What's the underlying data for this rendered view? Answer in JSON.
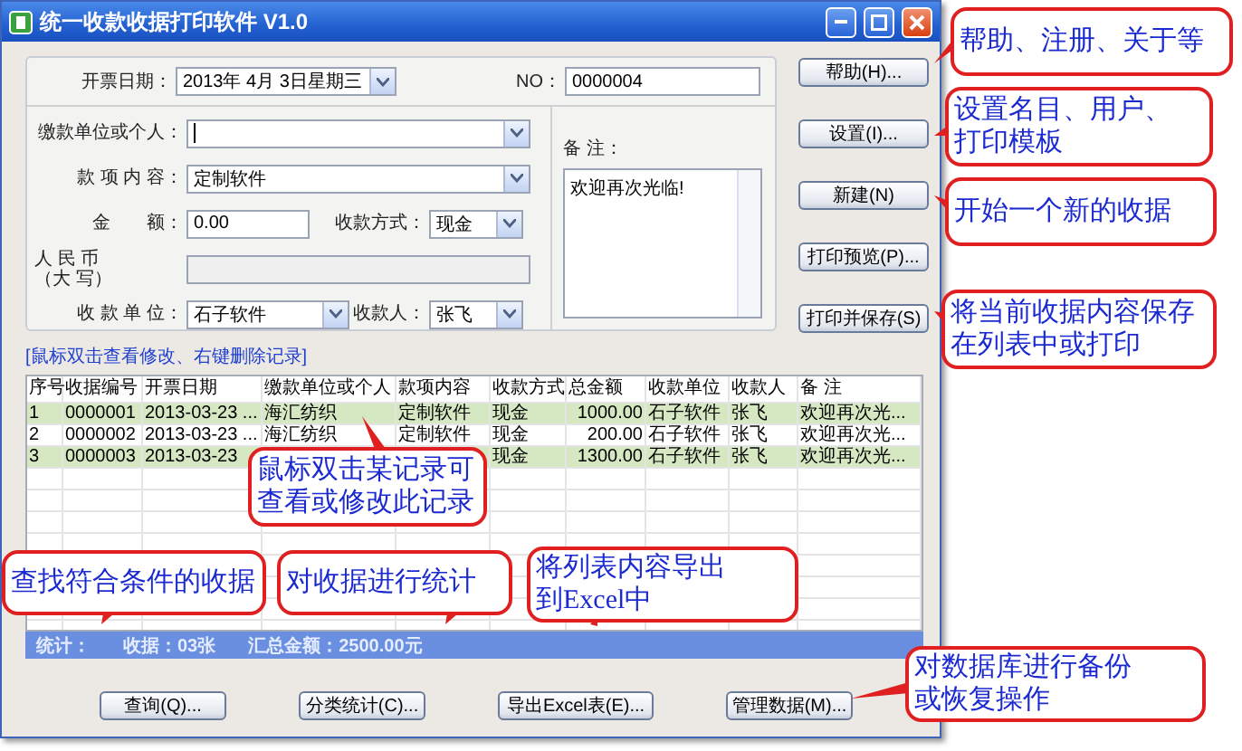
{
  "window": {
    "title": "统一收款收据打印软件 V1.0"
  },
  "form": {
    "date": {
      "label": "开票日期：",
      "value": "2013年 4月 3日星期三"
    },
    "number": {
      "label": "NO：",
      "value": "0000004"
    },
    "payer": {
      "label": "缴款单位或个人："
    },
    "item": {
      "label": "款 项 内 容：",
      "value": "定制软件"
    },
    "amount": {
      "label": "金　　额：",
      "value": "0.00"
    },
    "method": {
      "label": "收款方式：",
      "value": "现金"
    },
    "rmb": {
      "label": [
        "人 民 币",
        "（大 写）"
      ]
    },
    "unit": {
      "label": "收 款 单 位：",
      "value": "石子软件"
    },
    "payee": {
      "label": "收款人：",
      "value": "张飞"
    },
    "note": {
      "label": "备 注：",
      "value": "欢迎再次光临!"
    }
  },
  "side_buttons": [
    {
      "label": "帮助(H)..."
    },
    {
      "label": "设置(I)..."
    },
    {
      "label": "新建(N)"
    },
    {
      "label": "打印预览(P)..."
    },
    {
      "label": "打印并保存(S)"
    }
  ],
  "hint": "[鼠标双击查看修改、右键删除记录]",
  "table": {
    "columns": [
      "序号",
      "收据编号",
      "开票日期",
      "缴款单位或个人",
      "款项内容",
      "收款方式",
      "总金额",
      "收款单位",
      "收款人",
      "备 注"
    ],
    "rows": [
      {
        "seq": "1",
        "no": "0000001",
        "date": "2013-03-23 ...",
        "payer": "海汇纺织",
        "item": "定制软件",
        "method": "现金",
        "amount": "1000.00",
        "unit": "石子软件",
        "payee": "张飞",
        "note": "欢迎再次光..."
      },
      {
        "seq": "2",
        "no": "0000002",
        "date": "2013-03-23 ...",
        "payer": "海汇纺织",
        "item": "定制软件",
        "method": "现金",
        "amount": "200.00",
        "unit": "石子软件",
        "payee": "张飞",
        "note": "欢迎再次光..."
      },
      {
        "seq": "3",
        "no": "0000003",
        "date": "2013-03-23",
        "method": "现金",
        "amount": "1300.00",
        "unit": "石子软件",
        "payee": "张飞",
        "note": "欢迎再次光..."
      }
    ]
  },
  "status_bar": {
    "label": "统计：",
    "count": "收据：03张",
    "total": "汇总金额：2500.00元"
  },
  "bottom_buttons": [
    {
      "label": "查询(Q)..."
    },
    {
      "label": "分类统计(C)..."
    },
    {
      "label": "导出Excel表(E)..."
    },
    {
      "label": "管理数据(M)..."
    }
  ],
  "callouts": [
    {
      "lines": [
        "帮助、注册、关于等"
      ]
    },
    {
      "lines": [
        "设置名目、用户、",
        "打印模板"
      ]
    },
    {
      "lines": [
        "开始一个新的收据"
      ]
    },
    {
      "lines": [
        "将当前收据内容保存",
        "在列表中或打印"
      ]
    },
    {
      "lines": [
        "鼠标双击某记录可",
        "查看或修改此记录"
      ]
    },
    {
      "lines": [
        "查找符合条件的收据"
      ]
    },
    {
      "lines": [
        "对收据进行统计"
      ]
    },
    {
      "lines": [
        "将列表内容导出",
        "到Excel中"
      ]
    },
    {
      "lines": [
        "对数据库进行备份",
        "或恢复操作"
      ]
    }
  ]
}
